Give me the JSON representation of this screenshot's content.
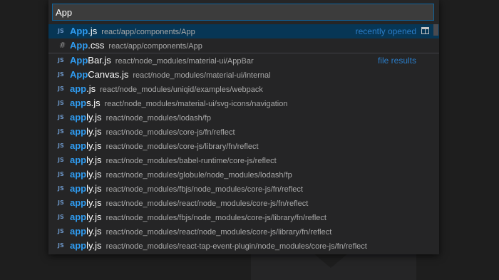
{
  "search": {
    "value": "App"
  },
  "colors": {
    "highlight": "#2f9cf1",
    "selected_bg": "#073655",
    "label_accent": "#2a7cc7"
  },
  "results": [
    {
      "icon": "js-file-icon",
      "badge": "JS",
      "match": "App",
      "rest": ".js",
      "path": "react/app/components/App",
      "label": "recently opened",
      "selected": true
    },
    {
      "icon": "css-file-icon",
      "badge": "#",
      "match": "App",
      "rest": ".css",
      "path": "react/app/components/App"
    },
    {
      "icon": "js-file-icon",
      "badge": "JS",
      "match": "App",
      "rest": "Bar.js",
      "path": "react/node_modules/material-ui/AppBar",
      "label": "file results",
      "separator": true
    },
    {
      "icon": "js-file-icon",
      "badge": "JS",
      "match": "App",
      "rest": "Canvas.js",
      "path": "react/node_modules/material-ui/internal"
    },
    {
      "icon": "js-file-icon",
      "badge": "JS",
      "match": "app",
      "rest": ".js",
      "path": "react/node_modules/uniqid/examples/webpack"
    },
    {
      "icon": "js-file-icon",
      "badge": "JS",
      "match": "app",
      "rest": "s.js",
      "path": "react/node_modules/material-ui/svg-icons/navigation"
    },
    {
      "icon": "js-file-icon",
      "badge": "JS",
      "match": "app",
      "rest": "ly.js",
      "path": "react/node_modules/lodash/fp"
    },
    {
      "icon": "js-file-icon",
      "badge": "JS",
      "match": "app",
      "rest": "ly.js",
      "path": "react/node_modules/core-js/fn/reflect"
    },
    {
      "icon": "js-file-icon",
      "badge": "JS",
      "match": "app",
      "rest": "ly.js",
      "path": "react/node_modules/core-js/library/fn/reflect"
    },
    {
      "icon": "js-file-icon",
      "badge": "JS",
      "match": "app",
      "rest": "ly.js",
      "path": "react/node_modules/babel-runtime/core-js/reflect"
    },
    {
      "icon": "js-file-icon",
      "badge": "JS",
      "match": "app",
      "rest": "ly.js",
      "path": "react/node_modules/globule/node_modules/lodash/fp"
    },
    {
      "icon": "js-file-icon",
      "badge": "JS",
      "match": "app",
      "rest": "ly.js",
      "path": "react/node_modules/fbjs/node_modules/core-js/fn/reflect"
    },
    {
      "icon": "js-file-icon",
      "badge": "JS",
      "match": "app",
      "rest": "ly.js",
      "path": "react/node_modules/react/node_modules/core-js/fn/reflect"
    },
    {
      "icon": "js-file-icon",
      "badge": "JS",
      "match": "app",
      "rest": "ly.js",
      "path": "react/node_modules/fbjs/node_modules/core-js/library/fn/reflect"
    },
    {
      "icon": "js-file-icon",
      "badge": "JS",
      "match": "app",
      "rest": "ly.js",
      "path": "react/node_modules/react/node_modules/core-js/library/fn/reflect"
    },
    {
      "icon": "js-file-icon",
      "badge": "JS",
      "match": "app",
      "rest": "ly.js",
      "path": "react/node_modules/react-tap-event-plugin/node_modules/core-js/fn/reflect"
    }
  ],
  "open_to_side_icon": "split-editor-icon"
}
